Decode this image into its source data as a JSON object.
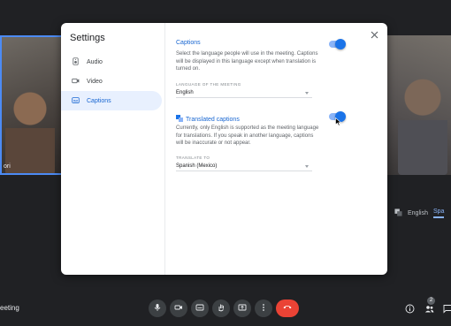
{
  "background": {
    "participant_name": "ori",
    "meeting_label": "eeting",
    "languages": {
      "current": "English",
      "target": "Spa"
    }
  },
  "controls": {
    "participants_count": "2",
    "icons": [
      "microphone-icon",
      "camera-icon",
      "captions-icon",
      "raise-hand-icon",
      "present-icon",
      "more-options-icon",
      "end-call-icon",
      "info-icon",
      "people-icon",
      "chat-icon"
    ]
  },
  "settings": {
    "title": "Settings",
    "nav": [
      {
        "label": "Audio",
        "icon": "speaker-icon"
      },
      {
        "label": "Video",
        "icon": "video-camera-icon"
      },
      {
        "label": "Captions",
        "icon": "captions-icon",
        "active": true
      }
    ],
    "captions": {
      "title": "Captions",
      "description": "Select the language people will use in the meeting. Captions will be displayed in this language except when translation is turned on.",
      "language_label": "Language of the meeting",
      "language_value": "English",
      "enabled": true
    },
    "translated": {
      "title": "Translated captions",
      "description": "Currently, only English is supported as the meeting language for translations. If you speak in another language, captions will be inaccurate or not appear.",
      "translate_label": "Translate to",
      "translate_value": "Spanish (Mexico)",
      "enabled": true
    }
  },
  "colors": {
    "accent": "#1a73e8",
    "end_call": "#ea4335",
    "dark_bg": "#202124",
    "nav_active_bg": "#e8f0fe"
  }
}
